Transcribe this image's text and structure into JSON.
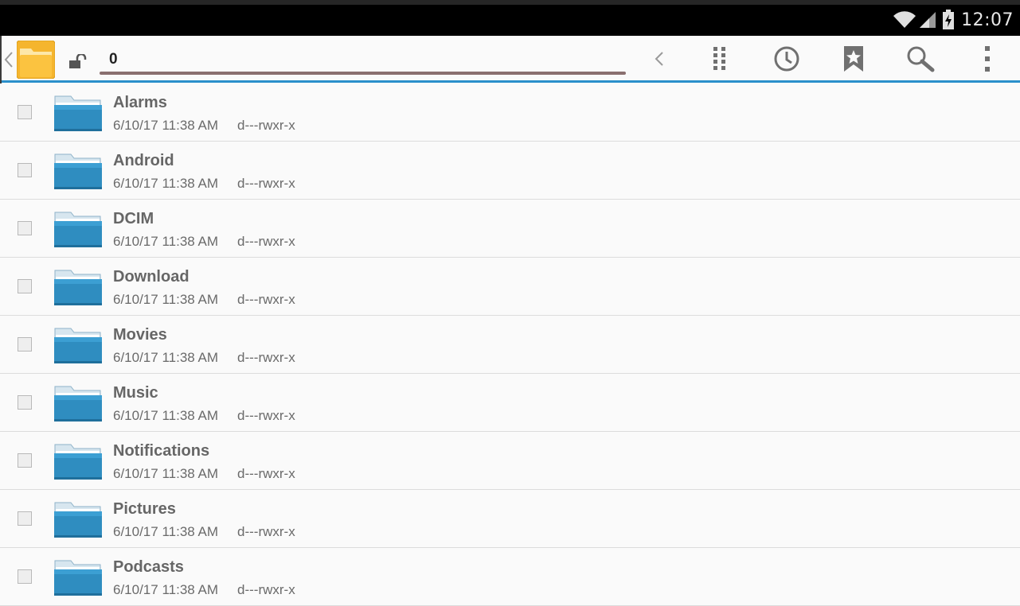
{
  "status_bar": {
    "time": "12:07",
    "icons": [
      "wifi-icon",
      "cell-signal-icon",
      "battery-charging-icon"
    ]
  },
  "toolbar": {
    "path_value": "0",
    "icons": [
      "back-chevron-icon",
      "app-folder-icon",
      "unlock-icon",
      "nav-back-icon",
      "grid-view-icon",
      "history-icon",
      "bookmark-icon",
      "search-icon",
      "overflow-menu-icon"
    ]
  },
  "colors": {
    "accent": "#2a8fcb",
    "folder": "#2f8dc0",
    "app_icon": "#f5b52e"
  },
  "files": [
    {
      "name": "Alarms",
      "date": "6/10/17 11:38 AM",
      "perm": "d---rwxr-x"
    },
    {
      "name": "Android",
      "date": "6/10/17 11:38 AM",
      "perm": "d---rwxr-x"
    },
    {
      "name": "DCIM",
      "date": "6/10/17 11:38 AM",
      "perm": "d---rwxr-x"
    },
    {
      "name": "Download",
      "date": "6/10/17 11:38 AM",
      "perm": "d---rwxr-x"
    },
    {
      "name": "Movies",
      "date": "6/10/17 11:38 AM",
      "perm": "d---rwxr-x"
    },
    {
      "name": "Music",
      "date": "6/10/17 11:38 AM",
      "perm": "d---rwxr-x"
    },
    {
      "name": "Notifications",
      "date": "6/10/17 11:38 AM",
      "perm": "d---rwxr-x"
    },
    {
      "name": "Pictures",
      "date": "6/10/17 11:38 AM",
      "perm": "d---rwxr-x"
    },
    {
      "name": "Podcasts",
      "date": "6/10/17 11:38 AM",
      "perm": "d---rwxr-x"
    }
  ]
}
